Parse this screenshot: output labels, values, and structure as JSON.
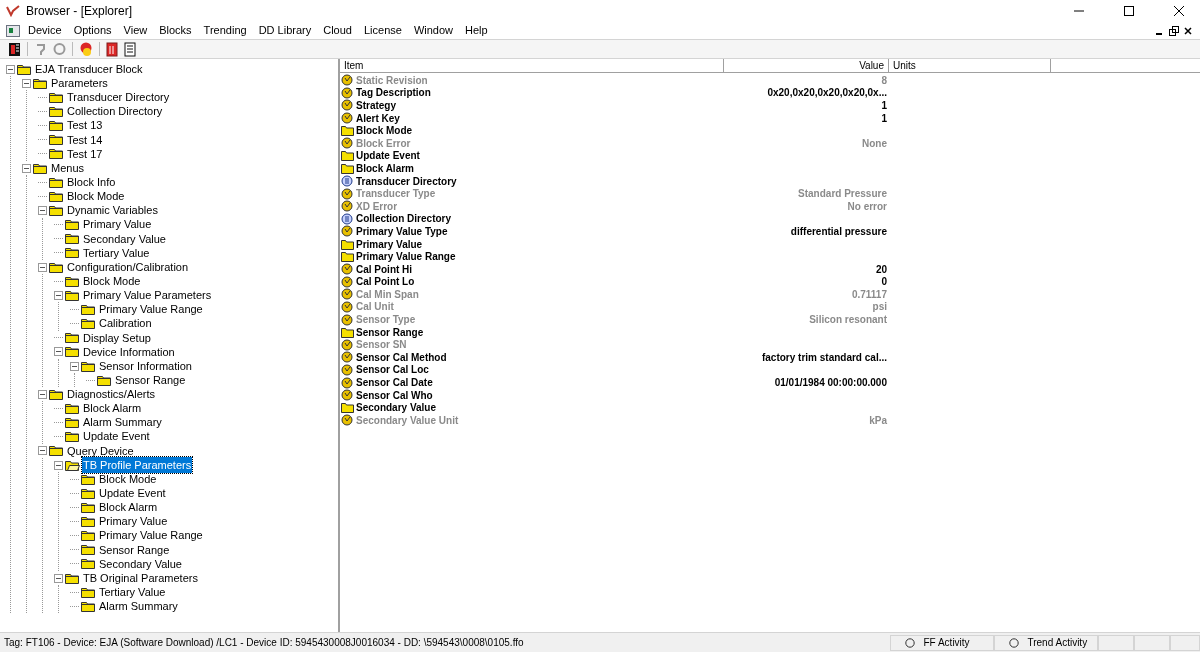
{
  "window": {
    "title": "Browser - [Explorer]"
  },
  "menu": [
    "Device",
    "Options",
    "View",
    "Blocks",
    "Trending",
    "DD Library",
    "Cloud",
    "License",
    "Window",
    "Help"
  ],
  "tree": [
    {
      "label": "EJA Transducer Block",
      "expanded": true,
      "selected": false,
      "children": [
        {
          "label": "Parameters",
          "expanded": true,
          "selected": false,
          "children": [
            {
              "label": "Transducer Directory",
              "selected": false
            },
            {
              "label": "Collection Directory",
              "selected": false
            },
            {
              "label": "Test 13",
              "selected": false
            },
            {
              "label": "Test 14",
              "selected": false
            },
            {
              "label": "Test 17",
              "selected": false
            }
          ]
        },
        {
          "label": "Menus",
          "expanded": true,
          "selected": false,
          "children": [
            {
              "label": "Block Info",
              "selected": false
            },
            {
              "label": "Block Mode",
              "selected": false
            },
            {
              "label": "Dynamic Variables",
              "expanded": true,
              "selected": false,
              "children": [
                {
                  "label": "Primary Value",
                  "selected": false
                },
                {
                  "label": "Secondary Value",
                  "selected": false
                },
                {
                  "label": "Tertiary Value",
                  "selected": false
                }
              ]
            },
            {
              "label": "Configuration/Calibration",
              "expanded": true,
              "selected": false,
              "children": [
                {
                  "label": "Block Mode",
                  "selected": false
                },
                {
                  "label": "Primary Value Parameters",
                  "expanded": true,
                  "selected": false,
                  "children": [
                    {
                      "label": "Primary Value Range",
                      "selected": false
                    },
                    {
                      "label": "Calibration",
                      "selected": false
                    }
                  ]
                },
                {
                  "label": "Display Setup",
                  "selected": false
                },
                {
                  "label": "Device Information",
                  "expanded": true,
                  "selected": false,
                  "children": [
                    {
                      "label": "Sensor Information",
                      "expanded": true,
                      "selected": false,
                      "children": [
                        {
                          "label": "Sensor Range",
                          "selected": false
                        }
                      ]
                    }
                  ]
                }
              ]
            },
            {
              "label": "Diagnostics/Alerts",
              "expanded": true,
              "selected": false,
              "children": [
                {
                  "label": "Block Alarm",
                  "selected": false
                },
                {
                  "label": "Alarm Summary",
                  "selected": false
                },
                {
                  "label": "Update Event",
                  "selected": false
                }
              ]
            },
            {
              "label": "Query Device",
              "expanded": true,
              "selected": false,
              "children": [
                {
                  "label": "TB Profile Parameters",
                  "expanded": true,
                  "selected": true,
                  "children": [
                    {
                      "label": "Block Mode",
                      "selected": false
                    },
                    {
                      "label": "Update Event",
                      "selected": false
                    },
                    {
                      "label": "Block Alarm",
                      "selected": false
                    },
                    {
                      "label": "Primary Value",
                      "selected": false
                    },
                    {
                      "label": "Primary Value Range",
                      "selected": false
                    },
                    {
                      "label": "Sensor Range",
                      "selected": false
                    },
                    {
                      "label": "Secondary Value",
                      "selected": false
                    }
                  ]
                },
                {
                  "label": "TB Original Parameters",
                  "expanded": true,
                  "selected": false,
                  "children": [
                    {
                      "label": "Tertiary Value",
                      "selected": false
                    },
                    {
                      "label": "Alarm Summary",
                      "selected": false
                    }
                  ]
                }
              ]
            }
          ]
        }
      ]
    }
  ],
  "table": {
    "columns": [
      "Item",
      "Value",
      "Units"
    ],
    "rows": [
      {
        "kind": "param",
        "item": "Static Revision",
        "value": "8",
        "disabled": true
      },
      {
        "kind": "param",
        "item": "Tag Description",
        "value": "0x20,0x20,0x20,0x20,0x...",
        "disabled": false
      },
      {
        "kind": "param",
        "item": "Strategy",
        "value": "1",
        "disabled": false
      },
      {
        "kind": "param",
        "item": "Alert Key",
        "value": "1",
        "disabled": false
      },
      {
        "kind": "folder",
        "item": "Block Mode",
        "disabled": false
      },
      {
        "kind": "param",
        "item": "Block Error",
        "value": "None",
        "disabled": true
      },
      {
        "kind": "folder",
        "item": "Update Event",
        "disabled": false
      },
      {
        "kind": "folder",
        "item": "Block Alarm",
        "disabled": false
      },
      {
        "kind": "directory",
        "item": "Transducer Directory",
        "disabled": false
      },
      {
        "kind": "param",
        "item": "Transducer Type",
        "value": "Standard Pressure",
        "disabled": true
      },
      {
        "kind": "param",
        "item": "XD Error",
        "value": "No error",
        "disabled": true
      },
      {
        "kind": "directory",
        "item": "Collection Directory",
        "disabled": false
      },
      {
        "kind": "param",
        "item": "Primary Value Type",
        "value": "differential pressure",
        "disabled": false
      },
      {
        "kind": "folder",
        "item": "Primary Value",
        "disabled": false
      },
      {
        "kind": "folder",
        "item": "Primary Value Range",
        "disabled": false
      },
      {
        "kind": "param",
        "item": "Cal Point Hi",
        "value": "20",
        "disabled": false
      },
      {
        "kind": "param",
        "item": "Cal Point Lo",
        "value": "0",
        "disabled": false
      },
      {
        "kind": "param",
        "item": "Cal Min Span",
        "value": "0.71117",
        "disabled": true
      },
      {
        "kind": "param",
        "item": "Cal Unit",
        "value": "psi",
        "disabled": true
      },
      {
        "kind": "param",
        "item": "Sensor Type",
        "value": "Silicon resonant",
        "disabled": true
      },
      {
        "kind": "folder",
        "item": "Sensor Range",
        "disabled": false
      },
      {
        "kind": "param",
        "item": "Sensor SN",
        "disabled": true
      },
      {
        "kind": "param",
        "item": "Sensor Cal Method",
        "value": "factory trim standard cal...",
        "disabled": false
      },
      {
        "kind": "param",
        "item": "Sensor Cal Loc",
        "disabled": false
      },
      {
        "kind": "param",
        "item": "Sensor Cal Date",
        "value": "01/01/1984 00:00:00.000",
        "disabled": false
      },
      {
        "kind": "param",
        "item": "Sensor Cal Who",
        "disabled": false
      },
      {
        "kind": "folder",
        "item": "Secondary Value",
        "disabled": false
      },
      {
        "kind": "param",
        "item": "Secondary Value Unit",
        "value": "kPa",
        "disabled": true
      }
    ]
  },
  "status_bar": {
    "text": "Tag: FT106 - Device: EJA (Software Download) /LC1 - Device ID: 5945430008J0016034 - DD: \\594543\\0008\\0105.ffo",
    "indicators": [
      "FF Activity",
      "Trend Activity"
    ]
  }
}
